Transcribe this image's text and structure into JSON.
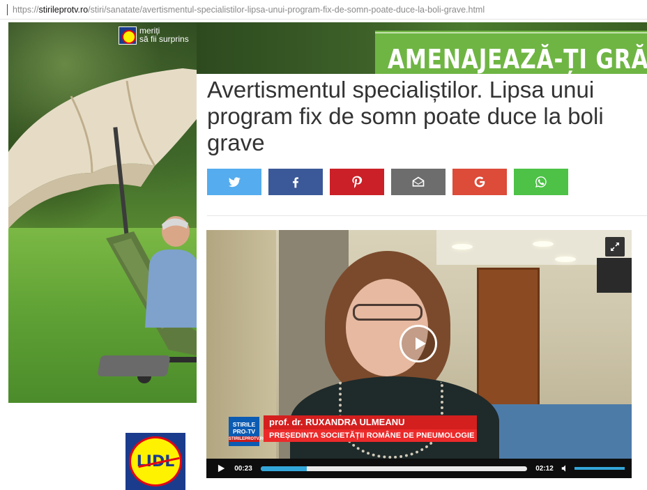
{
  "browser": {
    "url_scheme": "https://",
    "url_host": "stirileprotv.ro",
    "url_path": "/stiri/sanatate/avertismentul-specialistilor-lipsa-unui-program-fix-de-somn-poate-duce-la-boli-grave.html"
  },
  "ad": {
    "slogan_line1": "meriți",
    "slogan_line2": "să fii surprins",
    "banner_headline": "AMENAJEAZĂ-ȚI GRĂDI",
    "logo_word": "LIDL"
  },
  "article": {
    "title": "Avertismentul specialiștilor. Lipsa unui program fix de somn poate duce la boli grave"
  },
  "share": [
    {
      "name": "twitter",
      "icon": "twitter-icon",
      "color": "#55acee"
    },
    {
      "name": "facebook",
      "icon": "facebook-icon",
      "color": "#3b5998"
    },
    {
      "name": "pinterest",
      "icon": "pinterest-icon",
      "color": "#cb2027"
    },
    {
      "name": "email",
      "icon": "email-icon",
      "color": "#6d6d6d"
    },
    {
      "name": "google",
      "icon": "google-icon",
      "color": "#dd4b39"
    },
    {
      "name": "whatsapp",
      "icon": "whatsapp-icon",
      "color": "#4dc247"
    }
  ],
  "video": {
    "channel_logo_line1": "STIRILE",
    "channel_logo_line2": "PRO-TV",
    "channel_logo_sub": "STIRILEPROTV.RO",
    "lower_third_name": "prof. dr. RUXANDRA ULMEANU",
    "lower_third_role": "PREȘEDINTA SOCIETĂȚII ROMÂNE DE PNEUMOLOGIE",
    "time_current": "00:23",
    "time_total": "02:12",
    "progress_fraction": 0.174,
    "volume_fraction": 1.0
  }
}
